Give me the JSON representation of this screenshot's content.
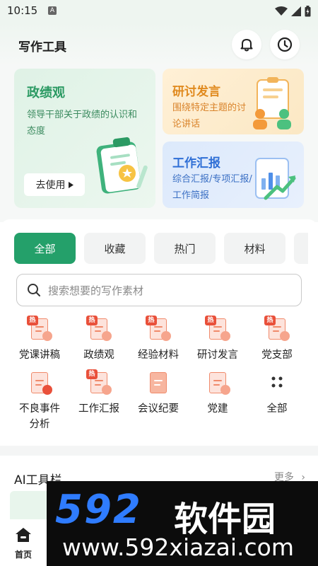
{
  "status_bar": {
    "time": "10:15",
    "notif_letter": "A"
  },
  "header": {
    "title": "写作工具",
    "bell_icon": "bell-icon",
    "history_icon": "clock-icon"
  },
  "banners": {
    "main": {
      "title": "政绩观",
      "desc": "领导干部关于政绩的认识和态度",
      "button": "去使用",
      "color": "#2b9a63"
    },
    "top_right": {
      "title": "研讨发言",
      "desc": "围绕特定主题的讨论讲话",
      "color": "#e08a1e"
    },
    "bottom_right": {
      "title": "工作汇报",
      "desc": "综合汇报/专项汇报/工作简报",
      "color": "#2f6fd6"
    }
  },
  "tabs": [
    {
      "label": "全部",
      "active": true
    },
    {
      "label": "收藏"
    },
    {
      "label": "热门"
    },
    {
      "label": "材料"
    }
  ],
  "search": {
    "placeholder": "搜索想要的写作素材",
    "icon": "search-icon"
  },
  "grid": [
    {
      "label": "党课讲稿",
      "hot": "热"
    },
    {
      "label": "政绩观",
      "hot": "热"
    },
    {
      "label": "经验材料",
      "hot": "热"
    },
    {
      "label": "研讨发言",
      "hot": "热"
    },
    {
      "label": "党支部",
      "hot": "热"
    },
    {
      "label": "不良事件分析"
    },
    {
      "label": "工作汇报",
      "hot": "热"
    },
    {
      "label": "会议纪要"
    },
    {
      "label": "党建"
    },
    {
      "label": "全部"
    }
  ],
  "ai_section": {
    "title": "AI工具栏",
    "more": "更多"
  },
  "bottom_nav": {
    "home_label": "首页"
  },
  "watermark": {
    "number": "592",
    "name": "软件园",
    "url": "www.592xiazai.com"
  }
}
